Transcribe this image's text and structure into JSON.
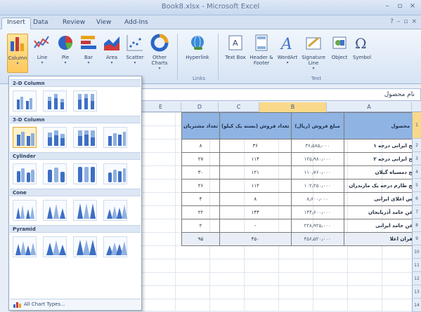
{
  "window": {
    "title": "Book8.xlsx - Microsoft Excel",
    "buttons": [
      "–",
      "▫",
      "×"
    ]
  },
  "tabs": [
    {
      "label": "Insert",
      "active": false
    },
    {
      "label": "Data",
      "active": false
    },
    {
      "label": "Review",
      "active": false
    },
    {
      "label": "View",
      "active": false
    },
    {
      "label": "Add-Ins",
      "active": false
    }
  ],
  "ribbon": {
    "charts": [
      {
        "label": "Column",
        "icon": "column-chart-icon"
      },
      {
        "label": "Line",
        "icon": "line-chart-icon"
      },
      {
        "label": "Pie",
        "icon": "pie-chart-icon"
      },
      {
        "label": "Bar",
        "icon": "bar-chart-icon"
      },
      {
        "label": "Area",
        "icon": "area-chart-icon"
      },
      {
        "label": "Scatter",
        "icon": "scatter-chart-icon"
      },
      {
        "label": "Other Charts",
        "icon": "other-charts-icon"
      }
    ],
    "links": {
      "label": "Hyperlink",
      "group": "Links"
    },
    "text": [
      {
        "label": "Text Box",
        "icon": "textbox-icon"
      },
      {
        "label": "Header & Footer",
        "icon": "header-footer-icon"
      },
      {
        "label": "WordArt",
        "icon": "wordart-icon"
      },
      {
        "label": "Signature Line",
        "icon": "signature-icon"
      },
      {
        "label": "Object",
        "icon": "object-icon"
      },
      {
        "label": "Symbol",
        "icon": "symbol-icon"
      }
    ],
    "text_group": "Text"
  },
  "formula": {
    "value": "نام محصول"
  },
  "sheet": {
    "columns": [
      "A",
      "B",
      "C",
      "D",
      "E"
    ],
    "rows": [
      "1",
      "2",
      "3",
      "4",
      "5",
      "6",
      "7",
      "8",
      "9",
      "10",
      "11",
      "12",
      "13",
      "14",
      "15"
    ],
    "headers": [
      "نام محصول",
      "مبلغ فروش (ریال)",
      "تعداد فروش (بسته یک کیلو)",
      "تعداد مشتریان"
    ],
    "data": [
      {
        "name": "برنج ایرانی درجه ۱",
        "amount": "۳۶٫۵۸۵٫۰۰۰",
        "qty": "۳۶",
        "customers": "۸"
      },
      {
        "name": "برنج ایرانی درجه ۲",
        "amount": "۱۲۵٫۹۸۰٫۰۰۰",
        "qty": "۱۱۴",
        "customers": "۲۷"
      },
      {
        "name": "برنج دمسیاه گیلان",
        "amount": "۱۱۰٫۷۶۰٫۰۰۰",
        "qty": "۱۲۱",
        "customers": "۳۰"
      },
      {
        "name": "برنج طارم درجه یک مازندران",
        "amount": "۱۰۲٫۲۵۰٫۰۰۰",
        "qty": "۱۱۲",
        "customers": "۲۶"
      },
      {
        "name": "عدس اعلای ایرانی",
        "amount": "۸٫۶۰۰٫۰۰۰",
        "qty": "۸",
        "customers": "۴"
      },
      {
        "name": "روغن جامد آذربایجان",
        "amount": "۱۴۴٫۶۰۰٫۰۰۰",
        "qty": "۱۴۴",
        "customers": "۲۲"
      },
      {
        "name": "روغن جامد ایرانی",
        "amount": "۲۲۸٫۹۲۵٫۰۰۰",
        "qty": "-",
        "customers": "۲"
      },
      {
        "name": "زعفران اعلا",
        "amount": "۴۵۶٫۵۲۰٫۰۰۰",
        "qty": "۴۵۰",
        "customers": "۹۵"
      }
    ]
  },
  "gallery": {
    "sections": [
      "2-D Column",
      "3-D Column",
      "Cylinder",
      "Cone",
      "Pyramid"
    ],
    "footer": "All Chart Types..."
  }
}
